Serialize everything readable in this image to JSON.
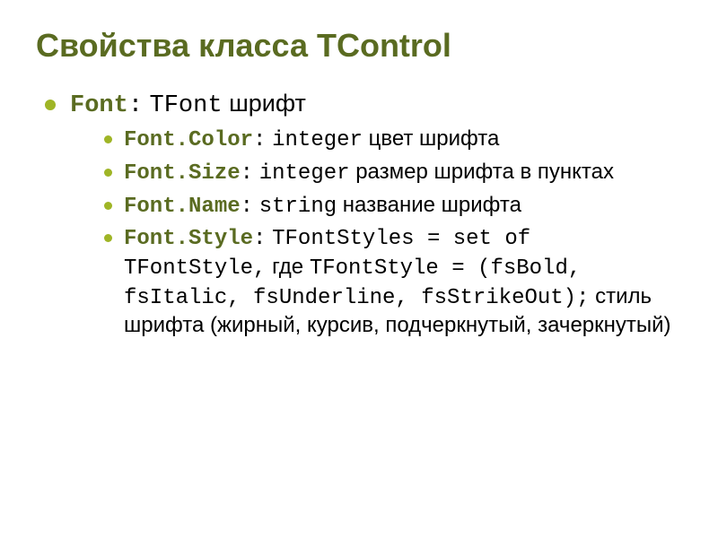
{
  "title": "Свойства класса TControl",
  "font": {
    "prop": "Font",
    "colon": ":",
    "type": "TFont",
    "desc": "шрифт"
  },
  "items": {
    "color": {
      "prop": "Font.Color",
      "colon": ":",
      "type": "integer",
      "desc": "цвет шрифта"
    },
    "size": {
      "prop": "Font.Size",
      "colon": ":",
      "type": "integer",
      "desc": "размер шрифта в пунктах"
    },
    "name": {
      "prop": "Font.Name",
      "colon": ":",
      "type": "string",
      "desc": "название шрифта"
    },
    "style": {
      "prop": "Font.Style",
      "colon": ":",
      "type_part1": "TFontStyles = set of TFontStyle,",
      "where": "где",
      "type_part2": "TFontStyle = (fsBold, fsItalic, fsUnderline, fsStrikeOut);",
      "desc": "стиль шрифта (жирный, курсив, подчеркнутый, зачеркнутый)"
    }
  }
}
